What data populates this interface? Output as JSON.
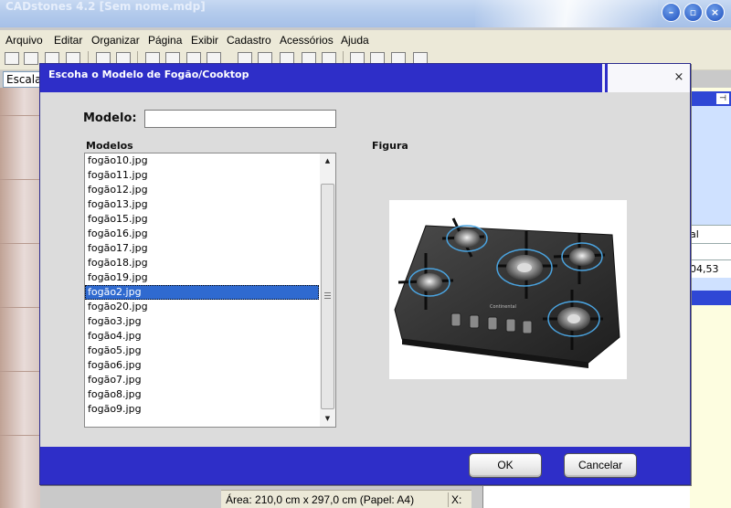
{
  "app": {
    "title": "CADstones 4.2  [Sem nome.mdp]",
    "menu": [
      "Arquivo",
      "Editar",
      "Organizar",
      "Página",
      "Exibir",
      "Cadastro",
      "Acessórios",
      "Ajuda"
    ],
    "scale_label": "Escala",
    "status": {
      "area_text": "Área: 210,0 cm  x  297,0 cm  (Papel: A4)",
      "x_label": "X:"
    },
    "side_panel": {
      "cell1": "al",
      "cell2": "04,53"
    },
    "window_controls": [
      "minimize-icon",
      "restore-icon",
      "close-icon"
    ]
  },
  "dialog": {
    "title": "Escoha o Modelo de Fogão/Cooktop",
    "close_glyph": "×",
    "model_label": "Modelo:",
    "model_value": "",
    "models_label": "Modelos",
    "figure_label": "Figura",
    "selected_index": 9,
    "models": [
      "fogão10.jpg",
      "fogão11.jpg",
      "fogão12.jpg",
      "fogão13.jpg",
      "fogão15.jpg",
      "fogão16.jpg",
      "fogão17.jpg",
      "fogão18.jpg",
      "fogão19.jpg",
      "fogão2.jpg",
      "fogão20.jpg",
      "fogão3.jpg",
      "fogão4.jpg",
      "fogão5.jpg",
      "fogão6.jpg",
      "fogão7.jpg",
      "fogão8.jpg",
      "fogão9.jpg"
    ],
    "figure_brand": "Continental",
    "ok_label": "OK",
    "cancel_label": "Cancelar"
  },
  "colors": {
    "dialog_accent": "#2e2ec8",
    "selection": "#2f6ad0",
    "dialog_body": "#dcdcdc"
  }
}
